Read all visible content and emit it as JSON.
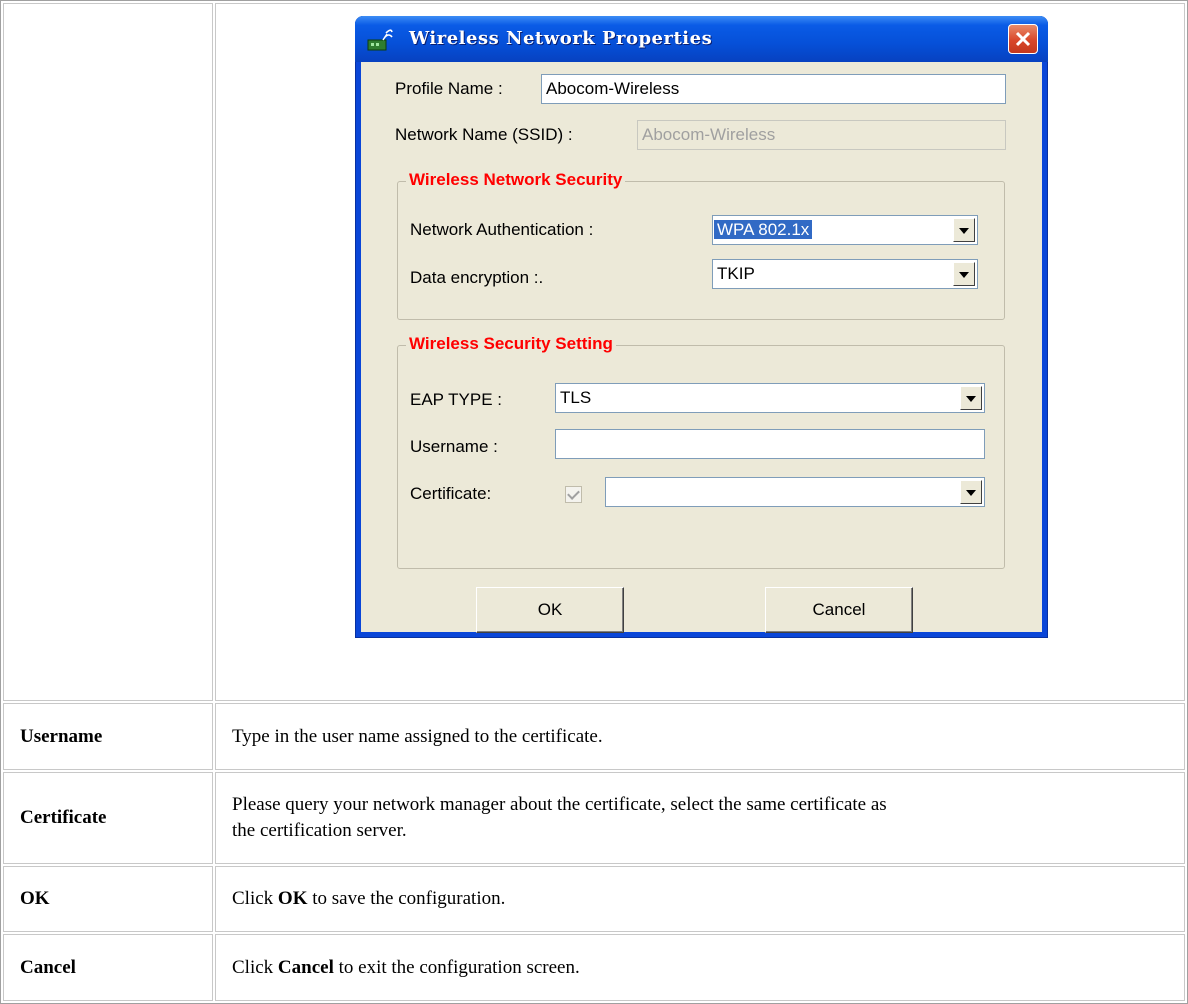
{
  "dialog": {
    "title": "Wireless Network Properties",
    "profile_name_label": "Profile Name :",
    "profile_name_value": "Abocom-Wireless",
    "ssid_label": "Network Name (SSID) :",
    "ssid_value": "Abocom-Wireless",
    "security_group_title": "Wireless Network Security",
    "auth_label": "Network Authentication :",
    "auth_value": "WPA 802.1x",
    "encryption_label": "Data encryption :.",
    "encryption_value": "TKIP",
    "setting_group_title": "Wireless Security Setting",
    "eap_label": "EAP TYPE :",
    "eap_value": "TLS",
    "username_label": "Username :",
    "username_value": "",
    "certificate_label": "Certificate:",
    "certificate_checked": true,
    "certificate_value": "",
    "ok_label": "OK",
    "cancel_label": "Cancel"
  },
  "table": {
    "rows": [
      {
        "key": "Username",
        "lines": [
          "Type in the user name assigned to the certificate."
        ]
      },
      {
        "key": "Certificate",
        "lines": [
          "Please query your network manager about the certificate, select the same certificate as",
          "the certification server."
        ]
      },
      {
        "key": "OK",
        "pre": "Click ",
        "bold": "OK",
        "post": " to save the configuration."
      },
      {
        "key": "Cancel",
        "pre": "Click ",
        "bold": "Cancel",
        "post": " to exit the configuration screen."
      }
    ]
  },
  "colors": {
    "titlebar": "#0a5be6",
    "dialog_face": "#ece9d8",
    "group_title": "#ff0000",
    "selection": "#316ac5"
  }
}
